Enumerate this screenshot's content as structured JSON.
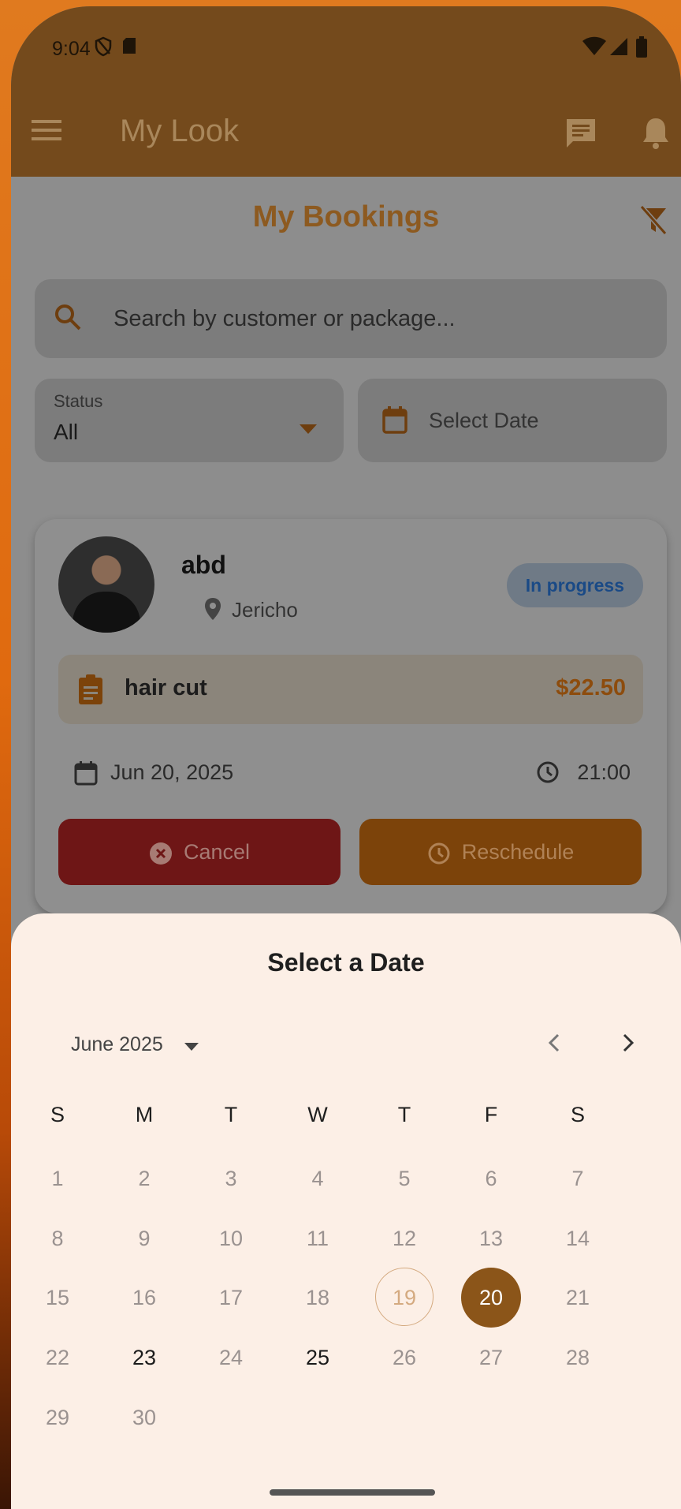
{
  "status_bar": {
    "time": "9:04"
  },
  "app_bar": {
    "title": "My Look",
    "icons": [
      "menu-icon",
      "chat-icon",
      "bell-icon"
    ]
  },
  "bookings": {
    "title": "My Bookings",
    "search_placeholder": "Search by customer or package...",
    "status_label": "Status",
    "status_value": "All",
    "date_placeholder": "Select Date"
  },
  "booking_card": {
    "customer": "abd",
    "location": "Jericho",
    "status": "In progress",
    "package": "hair cut",
    "price": "$22.50",
    "date": "Jun 20, 2025",
    "time": "21:00",
    "cancel_label": "Cancel",
    "reschedule_label": "Reschedule"
  },
  "date_picker": {
    "title": "Select a Date",
    "month_label": "June 2025",
    "weekdays": [
      "S",
      "M",
      "T",
      "W",
      "T",
      "F",
      "S"
    ],
    "first_weekday_index": 0,
    "days_in_month": 30,
    "today": 19,
    "selected": 20,
    "enabled_days": [
      20,
      23,
      25
    ]
  },
  "colors": {
    "accent": "#8b5519",
    "sheet_bg": "#fcefe6",
    "cancel": "#6e1616",
    "reschedule": "#7c430a"
  }
}
